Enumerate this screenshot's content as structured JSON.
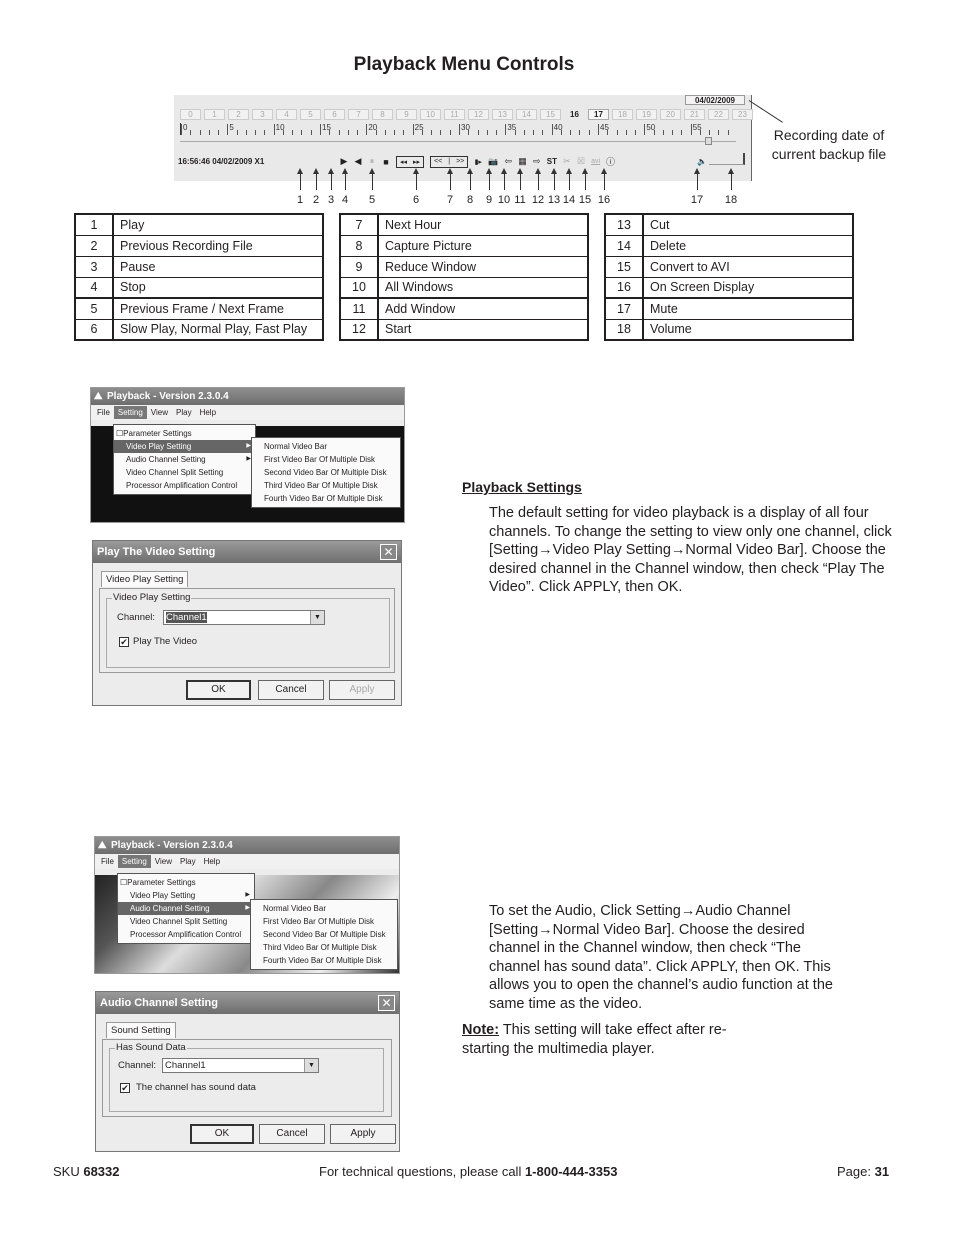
{
  "title": "Playback Menu Controls",
  "toolbar": {
    "date": "04/02/2009",
    "hours": [
      "0",
      "1",
      "2",
      "3",
      "4",
      "5",
      "6",
      "7",
      "8",
      "9",
      "10",
      "11",
      "12",
      "13",
      "14",
      "15",
      "16",
      "17",
      "18",
      "19",
      "20",
      "21",
      "22",
      "23"
    ],
    "active_hours": [
      "16",
      "17"
    ],
    "ruler_labels": [
      "0",
      "5",
      "10",
      "15",
      "20",
      "25",
      "30",
      "35",
      "40",
      "45",
      "50",
      "55"
    ],
    "status": "16:56:46 04/02/2009 X1",
    "controls": {
      "play": "▶",
      "prev_file": "◀",
      "pause": "⏸",
      "stop": "■",
      "frame_prev": "◂◂",
      "frame_next": "▸▸",
      "slow": "<<",
      "normal": "|",
      "fast": ">>",
      "next_hour": "▮▸",
      "capture": "📷",
      "reduce": "⇦",
      "all": "▦",
      "add": "⇨",
      "start": "ST",
      "cut": "✂",
      "delete": "☒",
      "avi": "avi",
      "osd": "ⓘ",
      "mute": "🔈"
    },
    "arrow_numbers": [
      "1",
      "2",
      "3",
      "4",
      "5",
      "6",
      "7",
      "8",
      "9",
      "10",
      "11",
      "12",
      "13",
      "14",
      "15",
      "16",
      "17",
      "18"
    ]
  },
  "callout": "Recording date of current backup file",
  "legend_tables": [
    [
      {
        "num": "1",
        "label": "Play"
      },
      {
        "num": "2",
        "label": "Previous Recording File"
      },
      {
        "num": "3",
        "label": "Pause"
      },
      {
        "num": "4",
        "label": "Stop"
      },
      {
        "num": "5",
        "label": "Previous Frame / Next Frame"
      },
      {
        "num": "6",
        "label": "Slow Play, Normal Play, Fast Play"
      }
    ],
    [
      {
        "num": "7",
        "label": "Next Hour"
      },
      {
        "num": "8",
        "label": "Capture Picture"
      },
      {
        "num": "9",
        "label": "Reduce Window"
      },
      {
        "num": "10",
        "label": "All Windows"
      },
      {
        "num": "11",
        "label": "Add Window"
      },
      {
        "num": "12",
        "label": "Start"
      }
    ],
    [
      {
        "num": "13",
        "label": "Cut"
      },
      {
        "num": "14",
        "label": "Delete"
      },
      {
        "num": "15",
        "label": "Convert to AVI"
      },
      {
        "num": "16",
        "label": "On Screen Display"
      },
      {
        "num": "17",
        "label": "Mute"
      },
      {
        "num": "18",
        "label": "Volume"
      }
    ]
  ],
  "app": {
    "title": "Playback - Version 2.3.0.4",
    "menubar": [
      "File",
      "Setting",
      "View",
      "Play",
      "Help"
    ],
    "setting_menu": [
      "Parameter Settings",
      "Video Play Setting",
      "Audio Channel Setting",
      "Video Channel Split Setting",
      "Processor Amplification Control"
    ],
    "submenu": [
      "Normal Video Bar",
      "First Video Bar Of Multiple Disk",
      "Second Video Bar Of Multiple Disk",
      "Third Video Bar Of Multiple Disk",
      "Fourth Video Bar Of Multiple Disk"
    ]
  },
  "video_dialog": {
    "title": "Play The Video Setting",
    "tab": "Video Play Setting",
    "group": "Video Play Setting",
    "channel_label": "Channel:",
    "channel_value": "Channel1",
    "checkbox_label": "Play The Video",
    "checked": true,
    "ok": "OK",
    "cancel": "Cancel",
    "apply": "Apply"
  },
  "audio_dialog": {
    "title": "Audio Channel Setting",
    "tab": "Sound Setting",
    "group": "Has Sound Data",
    "channel_label": "Channel:",
    "channel_value": "Channel1",
    "checkbox_label": "The channel has sound data",
    "checked": true,
    "ok": "OK",
    "cancel": "Cancel",
    "apply": "Apply"
  },
  "playback_settings": {
    "heading": "Playback Settings",
    "body": "The default setting for video playback is a display of all four channels. To change the setting to view only one channel, click [Setting→Video Play Setting→Normal Video Bar]. Choose the desired channel in the Channel window, then check “Play The Video”. Click APPLY, then OK."
  },
  "audio_text": "To set the Audio, Click Setting→Audio Channel [Setting→Normal Video Bar]. Choose the desired channel in the Channel window, then check “The channel has sound data”. Click APPLY, then OK. This allows you to open the channel’s audio function at the same time as the video.",
  "note": {
    "label": "Note:",
    "text": " This setting will take effect after re-starting the multimedia player."
  },
  "footer": {
    "sku_label": "SKU ",
    "sku": "68332",
    "help_text": "For technical questions, please call ",
    "phone": "1-800-444-3353",
    "page_label": "Page: ",
    "page": "31"
  }
}
